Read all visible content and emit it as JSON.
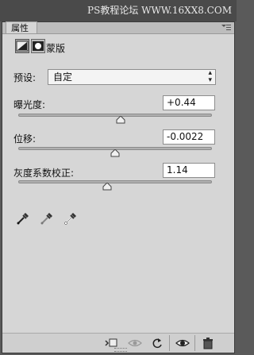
{
  "watermark": "PS教程论坛 WWW.16XX8.COM",
  "panel": {
    "tab_label": "属性",
    "menu_icon": "panel-menu-icon",
    "header": {
      "mask_label": "蒙版",
      "icons": [
        "adjustment-icon",
        "mask-icon"
      ]
    }
  },
  "preset": {
    "label": "预设:",
    "value": "自定"
  },
  "sliders": [
    {
      "label": "曝光度:",
      "value": "+0.44",
      "fraction": 0.53
    },
    {
      "label": "位移:",
      "value": "-0.0022",
      "fraction": 0.5
    },
    {
      "label": "灰度系数校正:",
      "value": "1.14",
      "fraction": 0.46
    }
  ],
  "eyedroppers": [
    "black-point-eyedropper-icon",
    "gray-point-eyedropper-icon",
    "white-point-eyedropper-icon"
  ],
  "footer_icons": [
    "clip-to-layer-icon",
    "view-previous-state-icon",
    "reset-icon",
    "visibility-eye-icon",
    "trash-icon"
  ]
}
